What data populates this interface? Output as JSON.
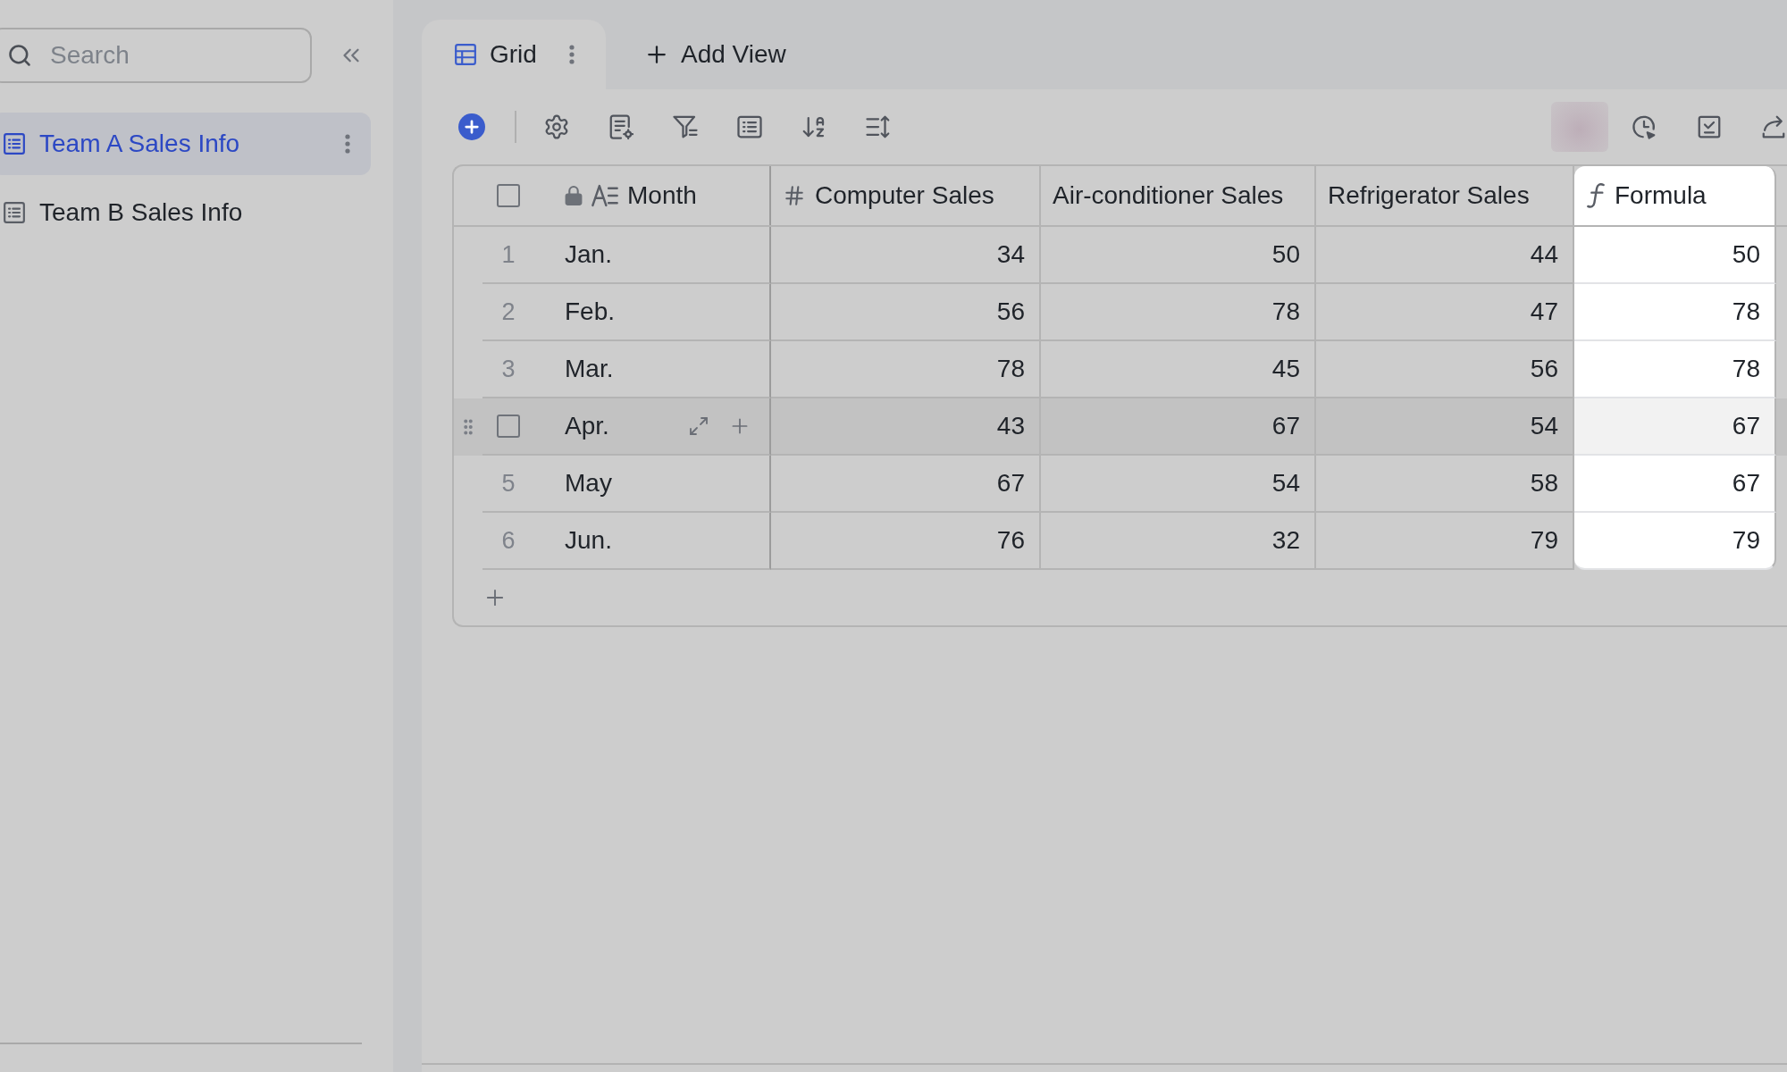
{
  "sidebar": {
    "search": {
      "placeholder": "Search"
    },
    "items": [
      {
        "label": "Team A Sales Info",
        "selected": true
      },
      {
        "label": "Team B Sales Info",
        "selected": false
      }
    ]
  },
  "view_tabs": [
    {
      "label": "Grid",
      "selected": true
    }
  ],
  "add_view": {
    "label": "Add View"
  },
  "table": {
    "select_all": {
      "checked": false
    },
    "columns": [
      {
        "label": "Month",
        "kind": "text",
        "locked": true,
        "selected": false
      },
      {
        "label": "Computer Sales",
        "kind": "number",
        "locked": false,
        "selected": false
      },
      {
        "label": "Air-conditioner Sales",
        "kind": "plain",
        "locked": false,
        "selected": false
      },
      {
        "label": "Refrigerator Sales",
        "kind": "plain",
        "locked": false,
        "selected": false
      },
      {
        "label": "Formula",
        "kind": "formula",
        "locked": false,
        "selected": true
      }
    ],
    "rows": [
      {
        "number": "1",
        "hovered": false,
        "checked": false,
        "cells": [
          "Jan.",
          "34",
          "50",
          "44",
          "50"
        ]
      },
      {
        "number": "2",
        "hovered": false,
        "checked": false,
        "cells": [
          "Feb.",
          "56",
          "78",
          "47",
          "78"
        ]
      },
      {
        "number": "3",
        "hovered": false,
        "checked": false,
        "cells": [
          "Mar.",
          "78",
          "45",
          "56",
          "78"
        ]
      },
      {
        "hovered": true,
        "checked": false,
        "cells": [
          "Apr.",
          "43",
          "67",
          "54",
          "67"
        ]
      },
      {
        "number": "5",
        "hovered": false,
        "checked": false,
        "cells": [
          "May",
          "67",
          "54",
          "58",
          "67"
        ]
      },
      {
        "number": "6",
        "hovered": false,
        "checked": false,
        "cells": [
          "Jun.",
          "76",
          "32",
          "79",
          "79"
        ]
      }
    ]
  }
}
